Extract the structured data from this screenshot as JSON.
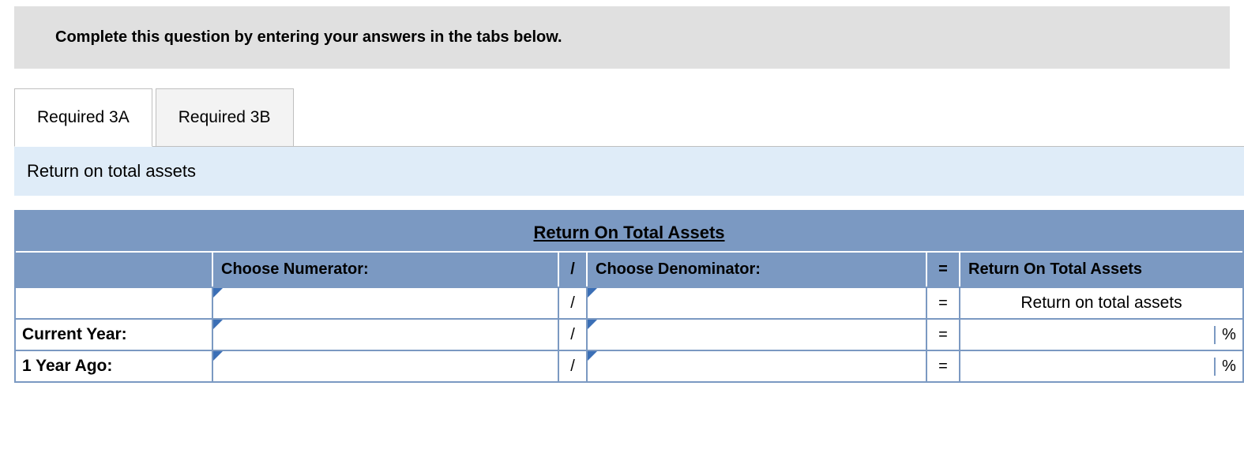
{
  "instruction": "Complete this question by entering your answers in the tabs below.",
  "tabs": [
    {
      "label": "Required 3A",
      "active": true
    },
    {
      "label": "Required 3B",
      "active": false
    }
  ],
  "description": "Return on total assets",
  "table": {
    "title": "Return On Total Assets",
    "headers": {
      "numerator": "Choose Numerator:",
      "divide": "/",
      "denominator": "Choose Denominator:",
      "equals": "=",
      "result": "Return On Total Assets"
    },
    "rows": [
      {
        "label": "",
        "static_result": "Return on total assets"
      },
      {
        "label": "Current Year:",
        "percent": "%"
      },
      {
        "label": "1 Year Ago:",
        "percent": "%"
      }
    ],
    "op_divide": "/",
    "op_equals": "="
  }
}
